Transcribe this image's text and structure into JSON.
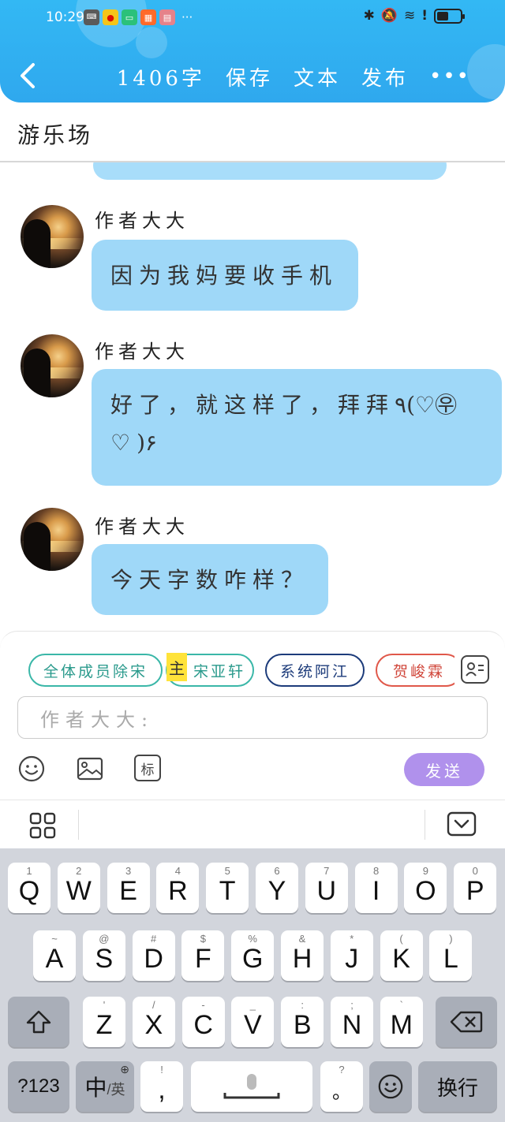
{
  "status_bar": {
    "time": "10:29",
    "more": "···"
  },
  "toolbar": {
    "word_count": "1406字",
    "save": "保存",
    "text": "文本",
    "publish": "发布",
    "more": "•••"
  },
  "page": {
    "title": "游乐场"
  },
  "messages": [
    {
      "sender": "作者大大",
      "text": "因为我妈要收手机"
    },
    {
      "sender": "作者大大",
      "text": "好了，就这样了，拜拜٩(♡㉾♡)۶"
    },
    {
      "sender": "作者大大",
      "text": "今天字数咋样？"
    }
  ],
  "composer": {
    "chips": [
      "全体成员除宋",
      "宋亚轩",
      "系统阿江",
      "贺峻霖"
    ],
    "highlight_char": "主",
    "input_placeholder": "作者大大:",
    "tag_tool": "标",
    "send": "发送"
  },
  "keyboard": {
    "row1": [
      {
        "k": "Q",
        "h": "1"
      },
      {
        "k": "W",
        "h": "2"
      },
      {
        "k": "E",
        "h": "3"
      },
      {
        "k": "R",
        "h": "4"
      },
      {
        "k": "T",
        "h": "5"
      },
      {
        "k": "Y",
        "h": "6"
      },
      {
        "k": "U",
        "h": "7"
      },
      {
        "k": "I",
        "h": "8"
      },
      {
        "k": "O",
        "h": "9"
      },
      {
        "k": "P",
        "h": "0"
      }
    ],
    "row2": [
      {
        "k": "A",
        "h": "~"
      },
      {
        "k": "S",
        "h": "@"
      },
      {
        "k": "D",
        "h": "#"
      },
      {
        "k": "F",
        "h": "$"
      },
      {
        "k": "G",
        "h": "%"
      },
      {
        "k": "H",
        "h": "&"
      },
      {
        "k": "J",
        "h": "*"
      },
      {
        "k": "K",
        "h": "("
      },
      {
        "k": "L",
        "h": ")"
      }
    ],
    "row3": [
      {
        "k": "Z",
        "h": "'"
      },
      {
        "k": "X",
        "h": "/"
      },
      {
        "k": "C",
        "h": "-"
      },
      {
        "k": "V",
        "h": "_"
      },
      {
        "k": "B",
        "h": ":"
      },
      {
        "k": "N",
        "h": ";"
      },
      {
        "k": "M",
        "h": "`"
      }
    ],
    "num_key": "?123",
    "lang_key": "中",
    "lang_alt": "/英",
    "comma_key": ",",
    "comma_hint": "!",
    "period_key": "。",
    "period_hint": "?",
    "enter_key": "换行"
  }
}
